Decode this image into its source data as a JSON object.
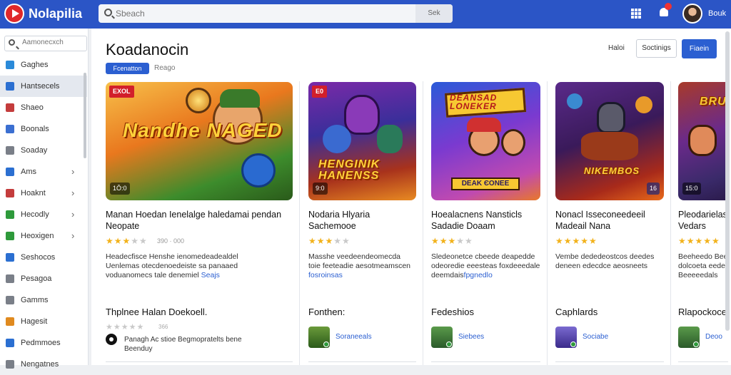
{
  "app": {
    "name": "Nolapilia"
  },
  "header": {
    "search_placeholder": "Sbeach",
    "search_button": "Sek",
    "user_name": "Bouk"
  },
  "sidebar": {
    "search_placeholder": "Aamonecxch",
    "items": [
      {
        "label": "Gaghes",
        "icon": "globe-icon",
        "color": "#2b8ad9",
        "chevron": false,
        "active": false
      },
      {
        "label": "Hantsecels",
        "icon": "bookmark-icon",
        "color": "#2b6fd1",
        "chevron": false,
        "active": true
      },
      {
        "label": "Shaeo",
        "icon": "person-icon",
        "color": "#c43c3c",
        "chevron": false,
        "active": false
      },
      {
        "label": "Boonals",
        "icon": "phone-icon",
        "color": "#3b6fd1",
        "chevron": false,
        "active": false
      },
      {
        "label": "Soaday",
        "icon": "tag-icon",
        "color": "#7a7f88",
        "chevron": false,
        "active": false
      },
      {
        "label": "Ams",
        "icon": "grid-icon",
        "color": "#2b6fd1",
        "chevron": true,
        "active": false
      },
      {
        "label": "Hoaknt",
        "icon": "calendar-icon",
        "color": "#c43c3c",
        "chevron": true,
        "active": false
      },
      {
        "label": "Hecodly",
        "icon": "gamepad-icon",
        "color": "#2e9a3b",
        "chevron": true,
        "active": false
      },
      {
        "label": "Heoxigen",
        "icon": "gamepad-icon",
        "color": "#2e9a3b",
        "chevron": true,
        "active": false
      },
      {
        "label": "Seshocos",
        "icon": "monitor-icon",
        "color": "#2b6fd1",
        "chevron": false,
        "active": false
      },
      {
        "label": "Pesagoa",
        "icon": "image-icon",
        "color": "#7a7f88",
        "chevron": false,
        "active": false
      },
      {
        "label": "Gamms",
        "icon": "chart-icon",
        "color": "#7a7f88",
        "chevron": false,
        "active": false
      },
      {
        "label": "Hagesit",
        "icon": "folder-icon",
        "color": "#e08a1f",
        "chevron": false,
        "active": false
      },
      {
        "label": "Pedmmoes",
        "icon": "document-icon",
        "color": "#2b6fd1",
        "chevron": false,
        "active": false
      },
      {
        "label": "Nengatnes",
        "icon": "list-icon",
        "color": "#7a7f88",
        "chevron": false,
        "active": false
      }
    ]
  },
  "main": {
    "title": "Koadanocin",
    "filter_active": "Fcenatton",
    "filter_other": "Reago",
    "actions": {
      "text_button": "Haloi",
      "outline_button": "Soctinigs",
      "primary_button": "Fiaein"
    }
  },
  "cards": [
    {
      "thumb_badge": "EXOL",
      "thumb_count": "1Ō:0",
      "art_text": "Nandhe NAGED",
      "title": "Manan Hoedan Ienelalge haledamai pendan Neopate",
      "stars": 3,
      "rating_meta": "390 · 000",
      "desc_lines": [
        "Headecfisce Henshe ienomedeadealdel",
        "Uenlemas otecdenoedeiste sa panaaed"
      ],
      "desc_tail": "voduanomecs tale denemiel",
      "desc_link": "Seajs",
      "section": "Thplnee Halan Doekoell.",
      "mini_meta": "366",
      "dev_text_1": "Panagh Ac stioe Begmopratelts bene",
      "dev_text_2": "Beenduy"
    },
    {
      "thumb_badge": "E0",
      "thumb_count": "9:0",
      "art_text": "HENGINIK HANENSS",
      "title": "Nodaria Hlyaria Sachemooe",
      "stars": 3,
      "rating_meta": "",
      "desc_lines": [
        "Masshe veedeendeomecda",
        "toie feeteadie aesotmeamscen"
      ],
      "desc_tail": "",
      "desc_link": "fosroinsas",
      "section": "Fonthen:",
      "dev_link": "Soraneeals"
    },
    {
      "thumb_badge": "",
      "thumb_count": "",
      "art_text": "DEANSAD LONEKER",
      "art_label": "DEAK ЄONEE",
      "title": "Hoealacnens Nansticls Sadadie Doaam",
      "stars": 3,
      "rating_meta": "",
      "desc_lines": [
        "Sledeonetce cbeede deapedde",
        "odeoredie eeesteas foxdeeedale"
      ],
      "desc_tail": "deemdais",
      "desc_link": "fpgnedlo",
      "section": "Fedeshios",
      "dev_link": "Siebees"
    },
    {
      "thumb_badge": "",
      "thumb_count": "16",
      "art_text": "NIKEMBOS",
      "title": "Nonacl Isseconeedeeil Madeail Nana",
      "stars": 5,
      "rating_meta": "",
      "desc_lines": [
        "Vembe dededeostcos deedes",
        "deneen edecdce aeosneets"
      ],
      "desc_tail": "",
      "desc_link": "",
      "section": "Caphlards",
      "dev_link": "Sociabe"
    },
    {
      "thumb_badge": "",
      "thumb_count": "15:0",
      "art_text": "BRUDEN",
      "title": "Pleodarielas Vedars",
      "stars": 5,
      "rating_meta": "",
      "desc_lines": [
        "Beeheedo Bee",
        "dolcoeta eede",
        "Beeeeedals"
      ],
      "desc_tail": "",
      "desc_link": "",
      "section": "Rlapockocel",
      "dev_link": "Deoo"
    }
  ],
  "colors": {
    "header": "#2b55c6",
    "accent": "#2b5fd1",
    "star": "#f2b21b"
  }
}
